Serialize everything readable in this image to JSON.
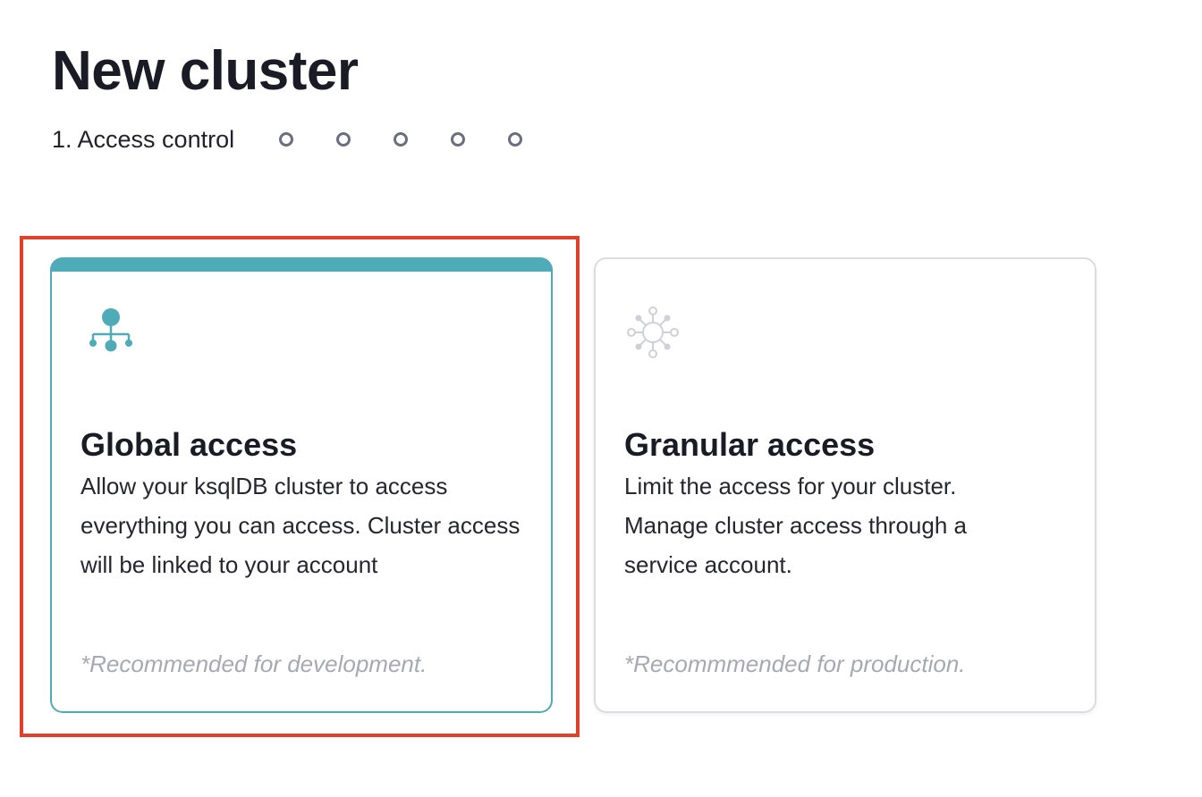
{
  "page": {
    "title": "New cluster"
  },
  "stepper": {
    "current_step_label": "1. Access control",
    "pending_steps": [
      "step-2",
      "step-3",
      "step-4",
      "step-5",
      "step-6"
    ]
  },
  "cards": {
    "global": {
      "icon": "hierarchy-icon",
      "title": "Global access",
      "description": "Allow your ksqlDB cluster to access everything you can access. Cluster access will be linked to your account",
      "note": "*Recommended for development.",
      "selected": true,
      "accent_color": "#4fabb8"
    },
    "granular": {
      "icon": "network-hub-icon",
      "title": "Granular access",
      "description": "Limit the access for your cluster. Manage cluster access through a service account.",
      "note": "*Recommmended for production.",
      "selected": false
    }
  },
  "highlight": {
    "color": "#e2402a"
  }
}
